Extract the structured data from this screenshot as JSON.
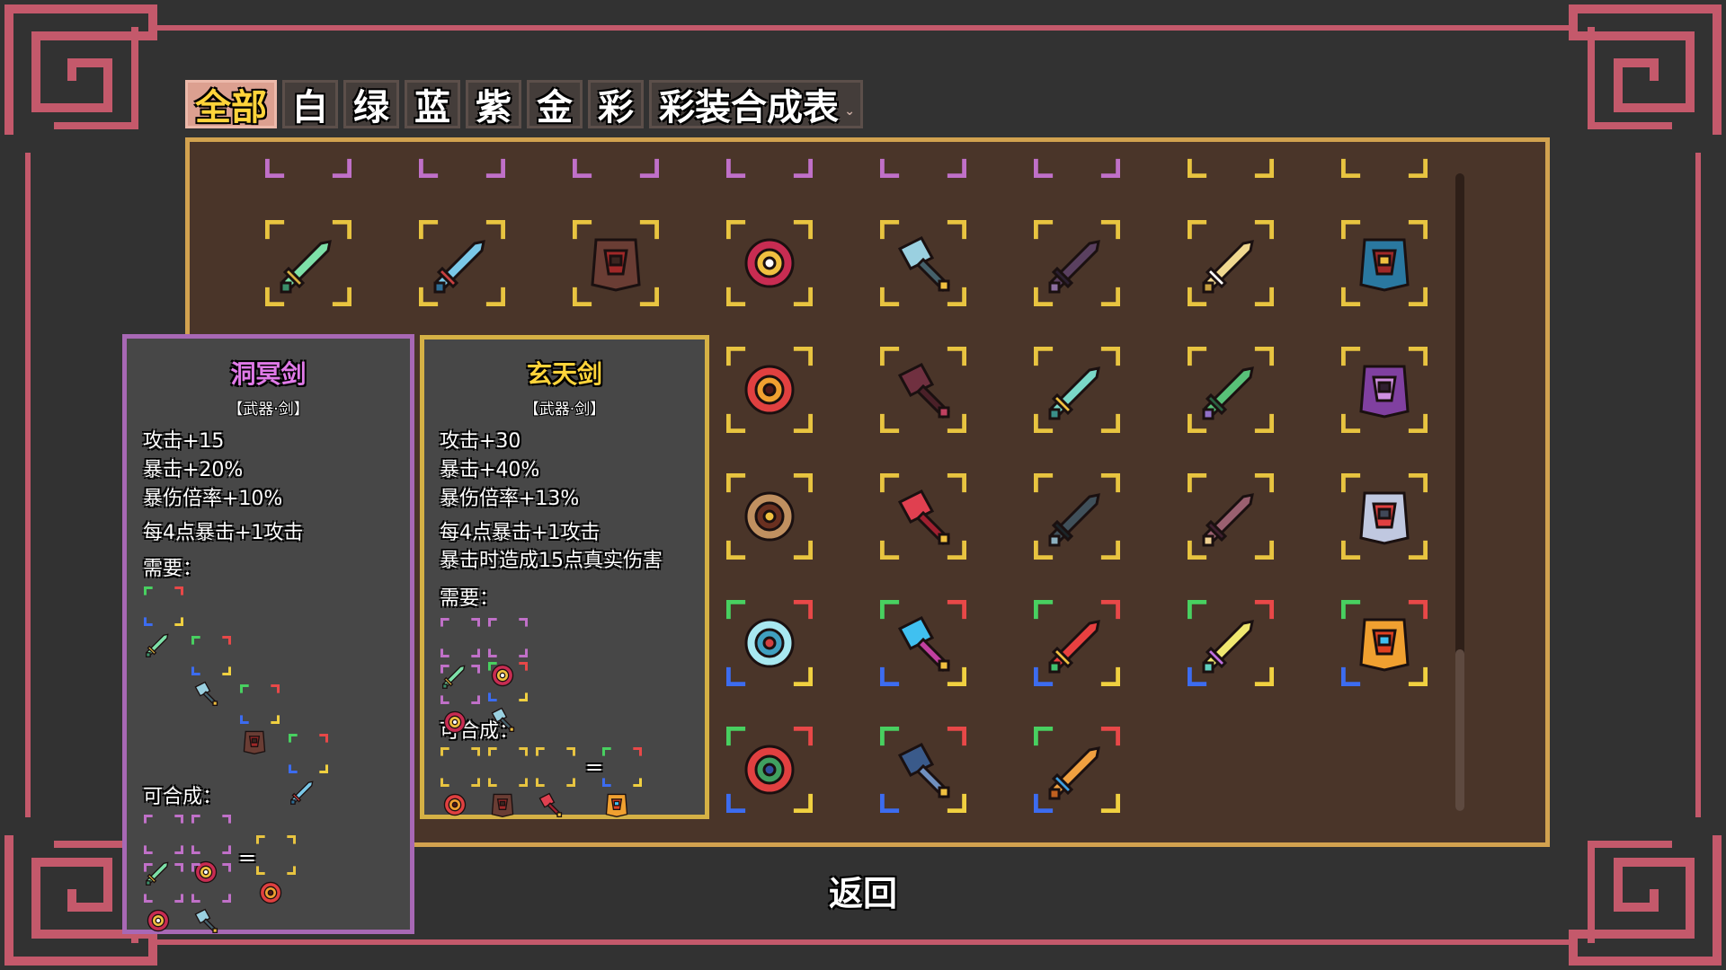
{
  "colors": {
    "frame": "#c4596b",
    "panel_border": "#d2a24f",
    "panel_bg": "#4a3529",
    "bg": "#323232",
    "rarity": {
      "white": "#ffffff",
      "purple": "#c070c8",
      "gold": "#e8c440",
      "rainbow": "rainbow"
    }
  },
  "tabs": [
    {
      "label": "全部",
      "active": true
    },
    {
      "label": "白"
    },
    {
      "label": "绿"
    },
    {
      "label": "蓝"
    },
    {
      "label": "紫"
    },
    {
      "label": "金"
    },
    {
      "label": "彩"
    },
    {
      "label": "彩装合成表",
      "dropdown": true
    }
  ],
  "grid": {
    "top_row": [
      "purple",
      "purple",
      "purple",
      "purple",
      "purple",
      "purple",
      "gold",
      "gold"
    ],
    "rows": [
      {
        "rarity": "gold",
        "items": [
          "sword-green-icon",
          "sword-blue-icon",
          "cloth-armor-icon",
          "shield-icon",
          "axe-icon",
          "stone-icon",
          "ring-icon",
          "chest-armor-icon"
        ]
      },
      {
        "rarity": "gold",
        "items": [
          "crossblade-icon",
          "egg-icon",
          "hammer-icon",
          "greatsword-icon",
          "dagger-icon"
        ]
      },
      {
        "rarity": "gold",
        "items": [
          "bow-icon",
          "red-dagger-icon",
          "anvil-icon",
          "gem-icon",
          "spear-icon"
        ]
      },
      {
        "rarity": "rainbow",
        "items": [
          "crystal-sword-icon",
          "blue-sword-icon",
          "rainbow-blade-icon",
          "book-icon",
          "flame-sword-icon"
        ]
      },
      {
        "rarity": "rainbow",
        "items": [
          "red-sword-icon",
          "tome-icon",
          "gold-sword-icon"
        ]
      }
    ]
  },
  "tooltip_left": {
    "name": "洞冥剑",
    "name_color": "#e07ae8",
    "type": "【武器·剑】",
    "stats": [
      "攻击+15",
      "暴击+20%",
      "暴伤倍率+10%",
      "每4点暴击+1攻击"
    ],
    "require_label": "需要：",
    "craft_label": "可合成："
  },
  "tooltip_right": {
    "name": "玄天剑",
    "name_color": "#ffd43a",
    "type": "【武器·剑】",
    "stats": [
      "攻击+30",
      "暴击+40%",
      "暴伤倍率+13%",
      "每4点暴击+1攻击",
      "暴击时造成15点真实伤害"
    ],
    "require_label": "需要：",
    "craft_label": "可合成：",
    "equals": "="
  },
  "back_label": "返回"
}
